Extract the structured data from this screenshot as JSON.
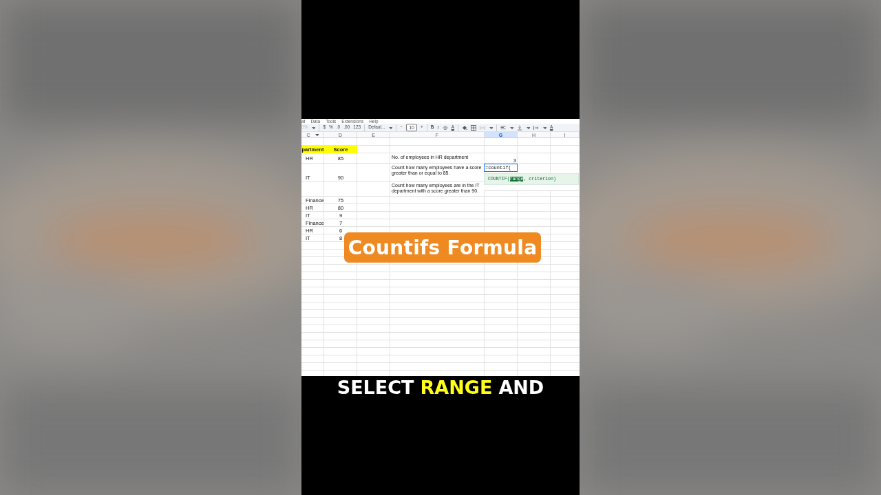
{
  "menu_bar": [
    "at",
    "Data",
    "Tools",
    "Extensions",
    "Help"
  ],
  "toolbar": {
    "zoom": "0%",
    "currency": "$",
    "percent": "%",
    "decrease_decimals": ".0",
    "increase_decimals": ".00",
    "number_format": "123",
    "font": "Defaul...",
    "decrease_size": "−",
    "font_size": "10",
    "increase_size": "+",
    "bold": "B",
    "italic": "I",
    "text_color": "A",
    "text_rotation": "A"
  },
  "columns": [
    {
      "label": "C",
      "selected": false
    },
    {
      "label": "D",
      "selected": false
    },
    {
      "label": "E",
      "selected": false
    },
    {
      "label": "F",
      "selected": false
    },
    {
      "label": "G",
      "selected": true
    },
    {
      "label": "H",
      "selected": false
    },
    {
      "label": "I",
      "selected": false
    }
  ],
  "rows": [
    {
      "kind": "header",
      "department": "partment",
      "score": "Score"
    },
    {
      "kind": "data",
      "department": "HR",
      "score": "85",
      "note": "No. of employees in HR department",
      "result": "3"
    },
    {
      "kind": "data",
      "department": "IT",
      "score": "90",
      "note": "Count how many employees have a score greater than or equal to 85.",
      "editing": "=countif("
    },
    {
      "kind": "data",
      "note": "Count how many employees are in the IT department with a score greater than 90."
    },
    {
      "kind": "data",
      "department": "Finance",
      "score": "75"
    },
    {
      "kind": "data",
      "department": "HR",
      "score": "80"
    },
    {
      "kind": "data",
      "department": "IT",
      "score": "9"
    },
    {
      "kind": "data",
      "department": "Finance",
      "score": "7"
    },
    {
      "kind": "data",
      "department": "HR",
      "score": "6"
    },
    {
      "kind": "data",
      "department": "IT",
      "score": "8"
    }
  ],
  "formula_hint": {
    "function": "COUNTIF(",
    "active_argument": "range",
    "rest": ", criterion)"
  },
  "title_badge": "Countifs Formula",
  "caption": [
    {
      "text": "SELECT",
      "highlight": false
    },
    {
      "text": "RANGE",
      "highlight": true
    },
    {
      "text": "AND",
      "highlight": false
    }
  ]
}
